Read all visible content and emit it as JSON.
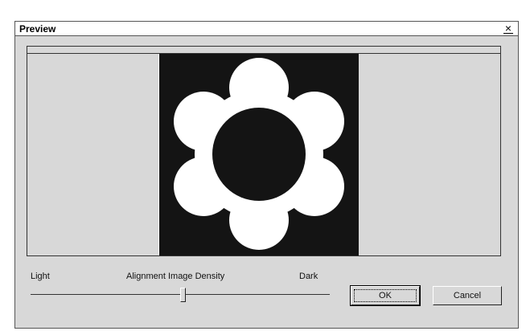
{
  "window": {
    "title": "Preview",
    "close_glyph": "×"
  },
  "preview": {
    "image_description_icon": "flower-image"
  },
  "slider": {
    "left_label": "Light",
    "center_label": "Alignment Image Density",
    "right_label": "Dark",
    "value_fraction": 0.51
  },
  "buttons": {
    "ok_label": "OK",
    "cancel_label": "Cancel"
  },
  "colors": {
    "dialog_background": "#d8d8d8",
    "image_background": "#141414",
    "flower_petals": "#ffffff"
  }
}
